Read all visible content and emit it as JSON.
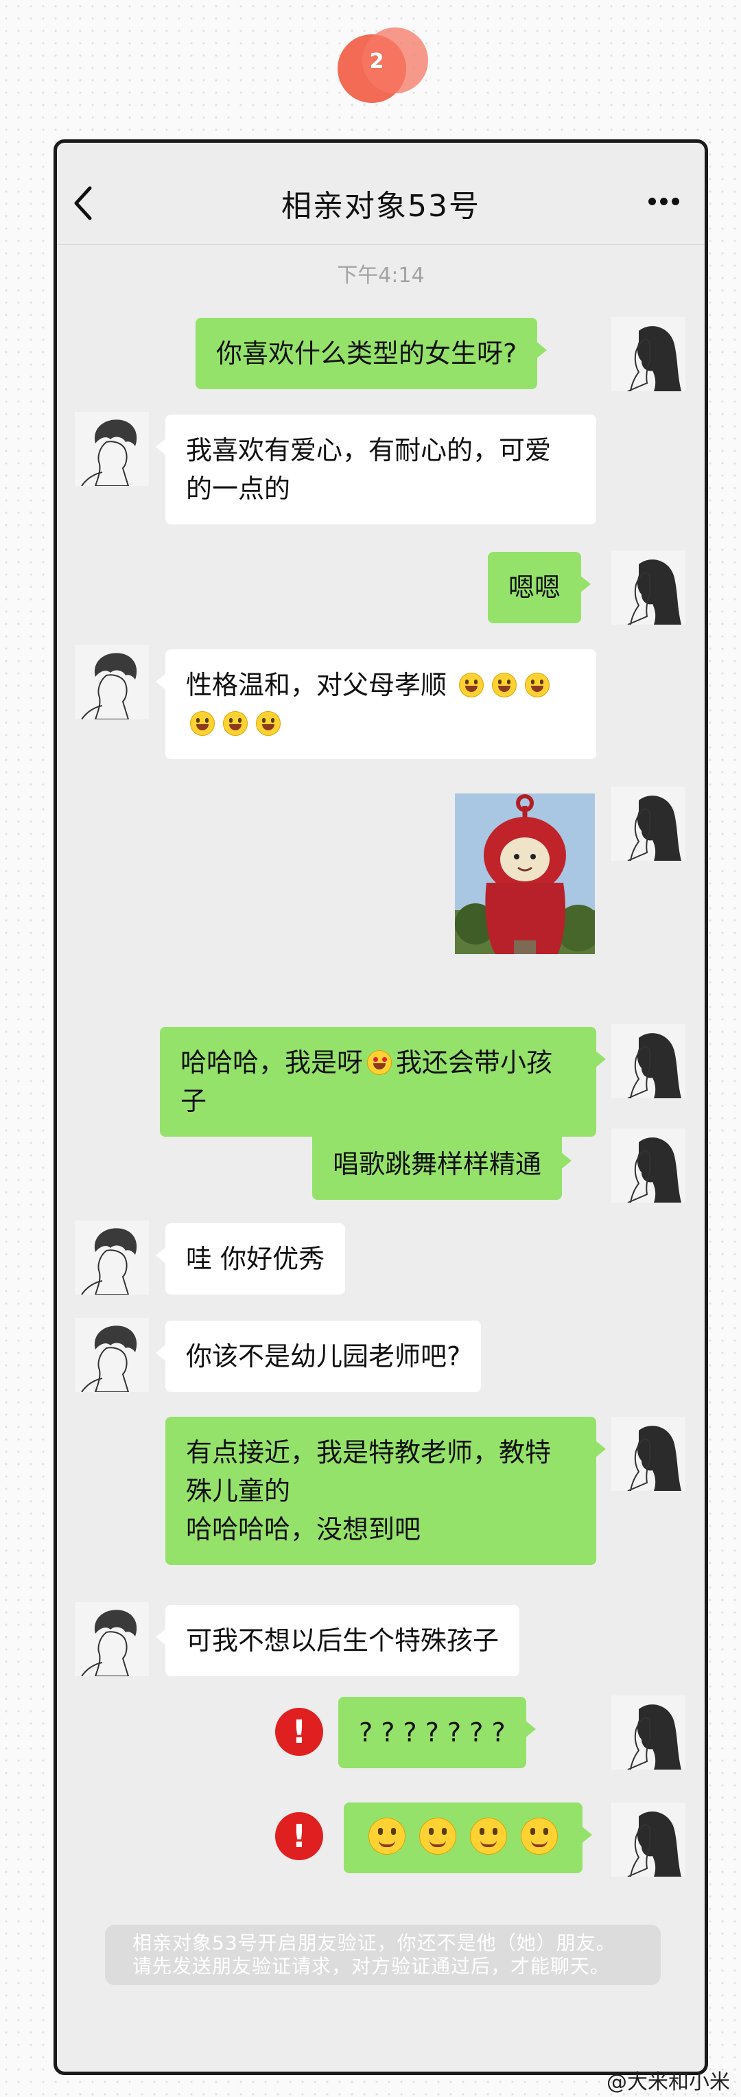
{
  "badge": {
    "number": "2"
  },
  "header": {
    "title": "相亲对象53号"
  },
  "timestamp": "下午4:14",
  "messages": [
    {
      "text": "你喜欢什么类型的女生呀?"
    },
    {
      "text": "我喜欢有爱心，有耐心的，可爱的一点的"
    },
    {
      "text": "嗯嗯"
    },
    {
      "text": "性格温和，对父母孝顺"
    },
    {
      "image": "teletubby-po-photo"
    },
    {
      "text_a": "哈哈哈，我是呀",
      "text_b": "我还会带小孩子"
    },
    {
      "text": "唱歌跳舞样样精通"
    },
    {
      "text": "哇 你好优秀"
    },
    {
      "text": "你该不是幼儿园老师吧?"
    },
    {
      "line1": "有点接近，我是特教老师，教特殊儿童的",
      "line2": "哈哈哈哈，没想到吧"
    },
    {
      "text": "可我不想以后生个特殊孩子"
    },
    {
      "text": "? ? ? ? ? ? ?",
      "status": "failed"
    },
    {
      "emoji": "smile-emoji x4",
      "status": "failed"
    }
  ],
  "error_icon_label": "!",
  "system_notice": "相亲对象53号开启朋友验证，你还不是他（她）朋友。请先发送朋友验证请求，对方验证通过后，才能聊天。",
  "watermark": "@大米和小米",
  "colors": {
    "my_bubble": "#95e26a",
    "other_bubble": "#ffffff",
    "chat_bg": "#ededed",
    "error": "#e02020",
    "badge": "#f36b55"
  }
}
